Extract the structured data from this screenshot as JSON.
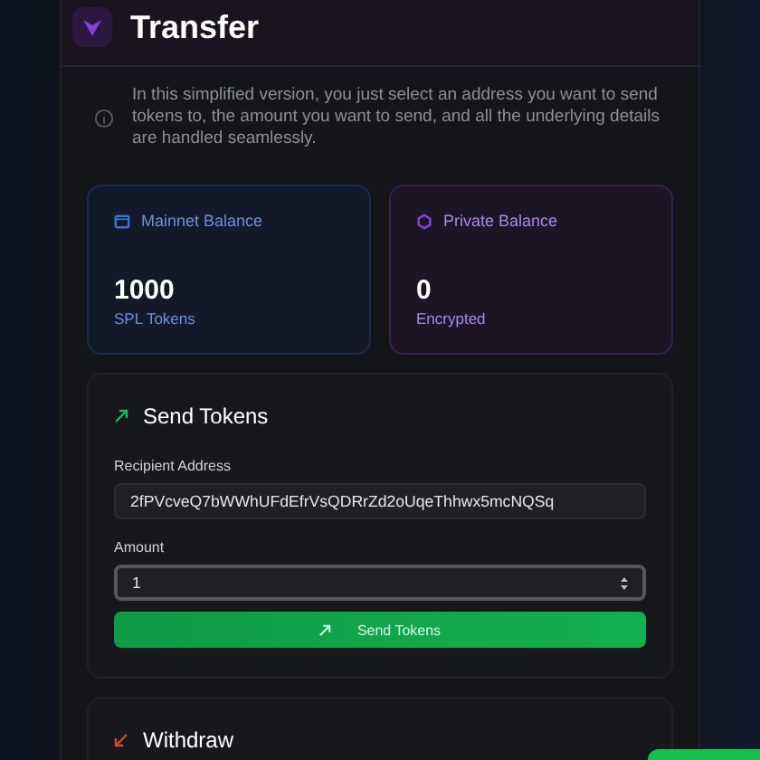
{
  "panel": {
    "title": "Transfer",
    "info": "In this simplified version, you just select an address you want to send tokens to, the amount you want to send, and all the underlying details are handled seamlessly."
  },
  "balances": [
    {
      "kind": "mainnet",
      "label": "Mainnet Balance",
      "amount": "1000",
      "unit": "SPL Tokens"
    },
    {
      "kind": "private",
      "label": "Private Balance",
      "amount": "0",
      "unit": "Encrypted"
    }
  ],
  "send": {
    "title": "Send Tokens",
    "fields": [
      {
        "kind": "text",
        "label": "Recipient Address",
        "value": "2fPVcveQ7bWWhUFdEfrVsQDRrZd2oUqeThhwx5mcNQSq",
        "focused": false
      },
      {
        "kind": "number",
        "label": "Amount",
        "value": "1",
        "focused": true
      }
    ],
    "button": "Send Tokens"
  },
  "withdraw": {
    "title": "Withdraw"
  }
}
